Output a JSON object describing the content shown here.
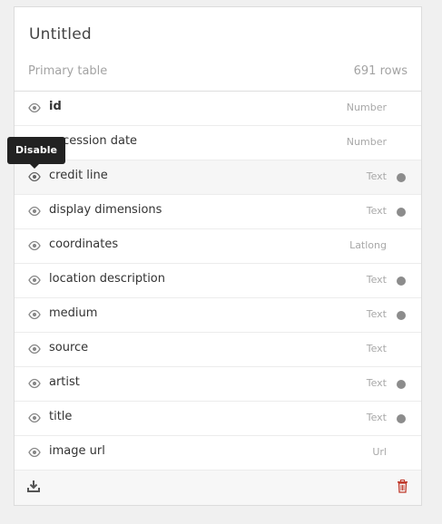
{
  "card": {
    "title": "Untitled",
    "subtitle": "Primary table",
    "row_count": "691 rows"
  },
  "tooltip": {
    "text": "Disable"
  },
  "columns": [
    {
      "name": "id",
      "type": "Number",
      "bold": true,
      "dot": false
    },
    {
      "name": "accession date",
      "type": "Number",
      "bold": false,
      "dot": false
    },
    {
      "name": "credit line",
      "type": "Text",
      "bold": false,
      "dot": true
    },
    {
      "name": "display dimensions",
      "type": "Text",
      "bold": false,
      "dot": true
    },
    {
      "name": "coordinates",
      "type": "Latlong",
      "bold": false,
      "dot": false
    },
    {
      "name": "location description",
      "type": "Text",
      "bold": false,
      "dot": true
    },
    {
      "name": "medium",
      "type": "Text",
      "bold": false,
      "dot": true
    },
    {
      "name": "source",
      "type": "Text",
      "bold": false,
      "dot": false
    },
    {
      "name": "artist",
      "type": "Text",
      "bold": false,
      "dot": true
    },
    {
      "name": "title",
      "type": "Text",
      "bold": false,
      "dot": true
    },
    {
      "name": "image url",
      "type": "Url",
      "bold": false,
      "dot": false
    }
  ],
  "icons": {
    "visibility": "eye-icon",
    "download": "download-icon",
    "delete": "trash-icon"
  },
  "colors": {
    "dot": "#8c8c8c",
    "delete": "#c0392b",
    "tooltip_bg": "#222222"
  }
}
